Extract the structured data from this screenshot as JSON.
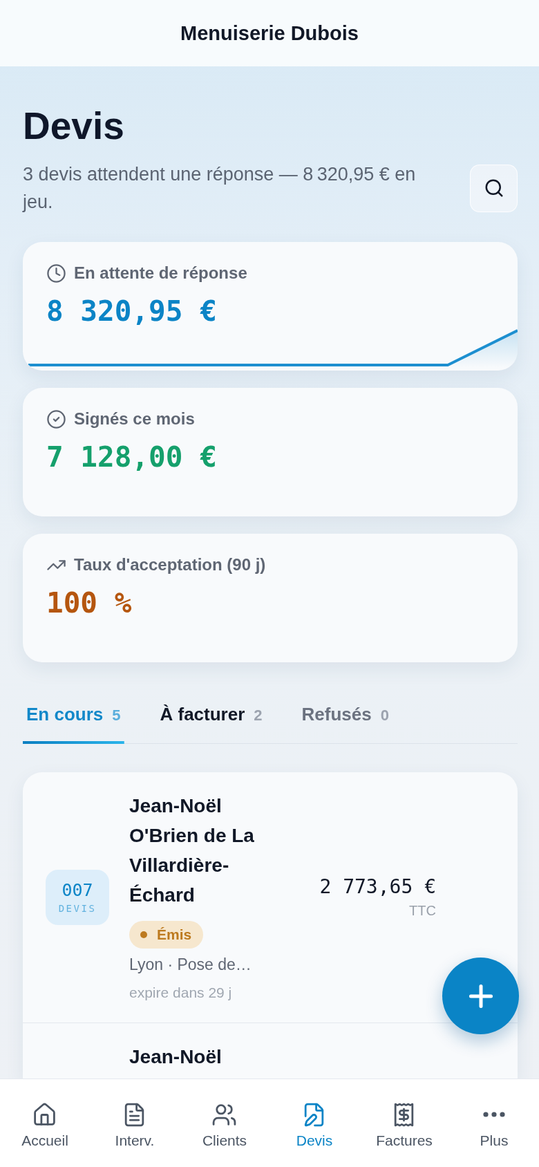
{
  "header": {
    "title": "Menuiserie Dubois"
  },
  "page": {
    "title": "Devis",
    "subtitle": "3 devis attendent une réponse — 8 320,95 € en jeu."
  },
  "stats": [
    {
      "kind": "pending",
      "label": "En attente de réponse",
      "value": "8 320,95 €"
    },
    {
      "kind": "signed",
      "label": "Signés ce mois",
      "value": "7 128,00 €"
    },
    {
      "kind": "rate",
      "label": "Taux d'acceptation (90 j)",
      "value": "100 %"
    }
  ],
  "tabs": [
    {
      "label": "En cours",
      "count": "5",
      "selected": true,
      "disabled": false
    },
    {
      "label": "À facturer",
      "count": "2",
      "selected": false,
      "disabled": false
    },
    {
      "label": "Refusés",
      "count": "0",
      "selected": false,
      "disabled": true
    }
  ],
  "quotes": [
    {
      "number": "007",
      "number_label": "DEVIS",
      "client": "Jean-Noël O'Brien de La Villardière-Échard",
      "status": {
        "label": "Émis",
        "color": "#bd7a1f"
      },
      "place": "Lyon · Pose de…",
      "expiry": "expire dans 29 j",
      "amount": "2 773,65 €",
      "amount_note": "TTC"
    },
    {
      "client": "Jean-Noël"
    }
  ],
  "nav": [
    {
      "label": "Accueil",
      "selected": false
    },
    {
      "label": "Interv.",
      "selected": false
    },
    {
      "label": "Clients",
      "selected": false
    },
    {
      "label": "Devis",
      "selected": true
    },
    {
      "label": "Factures",
      "selected": false
    },
    {
      "label": "Plus",
      "selected": false
    }
  ]
}
